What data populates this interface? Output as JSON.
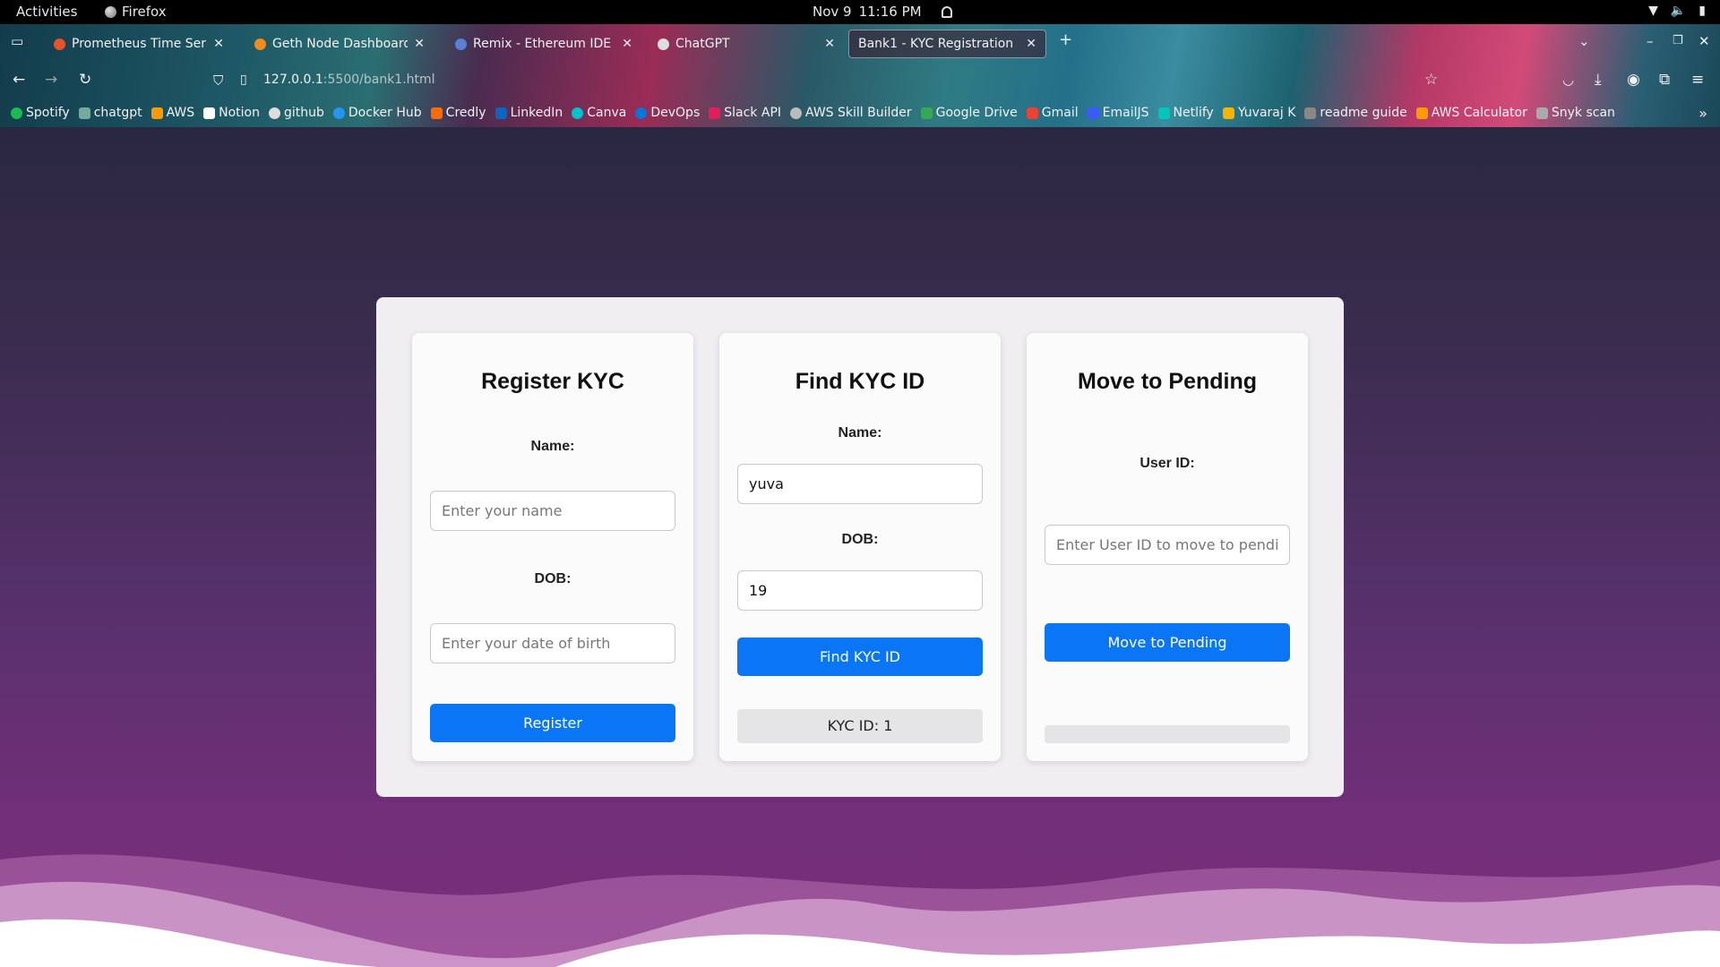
{
  "system_bar": {
    "activities": "Activities",
    "app_name": "Firefox",
    "date": "Nov 9",
    "time": "11:16 PM"
  },
  "browser": {
    "tabs": [
      {
        "label": "Prometheus Time Series",
        "favicon_color": "#e6522c"
      },
      {
        "label": "Geth Node Dashboard (F",
        "favicon_color": "#f28c1e"
      },
      {
        "label": "Remix - Ethereum IDE",
        "favicon_color": "#5a7fd6"
      },
      {
        "label": "ChatGPT",
        "favicon_color": "#dddddd"
      },
      {
        "label": "Bank1 - KYC Registration",
        "favicon_color": "",
        "active": true
      }
    ],
    "url_host": "127.0.0.1",
    "url_path": ":5500/bank1.html",
    "bookmarks": [
      {
        "label": "Spotify",
        "color": "#1db954"
      },
      {
        "label": "chatgpt",
        "color": "#74aa9c"
      },
      {
        "label": "AWS",
        "color": "#ff9900"
      },
      {
        "label": "Notion",
        "color": "#ffffff"
      },
      {
        "label": "github",
        "color": "#dddddd"
      },
      {
        "label": "Docker Hub",
        "color": "#2496ed"
      },
      {
        "label": "Credly",
        "color": "#ff6b00"
      },
      {
        "label": "LinkedIn",
        "color": "#0a66c2"
      },
      {
        "label": "Canva",
        "color": "#00c4cc"
      },
      {
        "label": "DevOps",
        "color": "#0078d7"
      },
      {
        "label": "Slack API",
        "color": "#e01e5a"
      },
      {
        "label": "AWS Skill Builder",
        "color": "#bbbbbb"
      },
      {
        "label": "Google Drive",
        "color": "#34a853"
      },
      {
        "label": "Gmail",
        "color": "#ea4335"
      },
      {
        "label": "EmailJS",
        "color": "#3d5afe"
      },
      {
        "label": "Netlify",
        "color": "#00c7b7"
      },
      {
        "label": "Yuvaraj K",
        "color": "#f4b400"
      },
      {
        "label": "readme guide",
        "color": "#888888"
      },
      {
        "label": "AWS Calculator",
        "color": "#ff9900"
      },
      {
        "label": "Snyk scan",
        "color": "#aaaaaa"
      }
    ]
  },
  "register": {
    "title": "Register KYC",
    "name_label": "Name:",
    "name_placeholder": "Enter your name",
    "dob_label": "DOB:",
    "dob_placeholder": "Enter your date of birth",
    "button": "Register"
  },
  "find": {
    "title": "Find KYC ID",
    "name_label": "Name:",
    "name_value": "yuva",
    "dob_label": "DOB:",
    "dob_value": "19",
    "button": "Find KYC ID",
    "result": "KYC ID: 1"
  },
  "pending": {
    "title": "Move to Pending",
    "userid_label": "User ID:",
    "userid_placeholder": "Enter User ID to move to pending",
    "button": "Move to Pending",
    "result": ""
  }
}
